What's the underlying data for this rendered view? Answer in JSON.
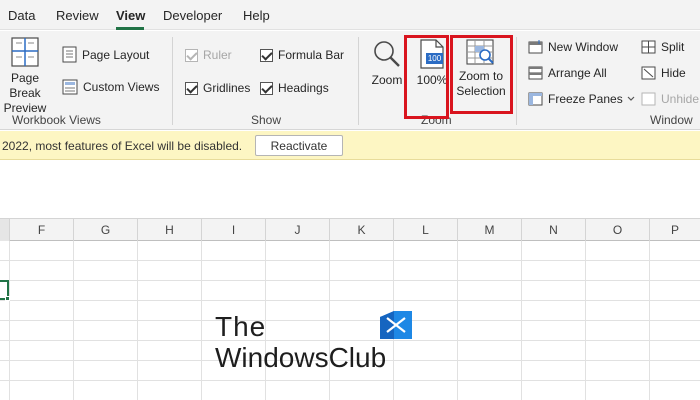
{
  "tabs": [
    {
      "label": "Data"
    },
    {
      "label": "Review"
    },
    {
      "label": "View",
      "active": true
    },
    {
      "label": "Developer"
    },
    {
      "label": "Help"
    }
  ],
  "workbook_views": {
    "group_label": "Workbook Views",
    "page_break_preview_line1": "Page Break",
    "page_break_preview_line2": "Preview",
    "page_layout": "Page Layout",
    "custom_views": "Custom Views"
  },
  "show": {
    "group_label": "Show",
    "ruler": "Ruler",
    "formula_bar": "Formula Bar",
    "gridlines": "Gridlines",
    "headings": "Headings"
  },
  "zoom": {
    "group_label": "Zoom",
    "zoom_label": "Zoom",
    "zoom_100_label": "100%",
    "zoom_100_icon_text": "100",
    "zoom_to_selection_line1": "Zoom to",
    "zoom_to_selection_line2": "Selection"
  },
  "window": {
    "group_label": "Window",
    "new_window": "New Window",
    "arrange_all": "Arrange All",
    "freeze_panes": "Freeze Panes",
    "split": "Split",
    "hide": "Hide",
    "unhide": "Unhide"
  },
  "message_bar": {
    "text": "2022, most features of Excel will be disabled.",
    "button": "Reactivate"
  },
  "columns": [
    "F",
    "G",
    "H",
    "I",
    "J",
    "K",
    "L",
    "M",
    "N",
    "O",
    "P"
  ],
  "watermark": {
    "line1": "The",
    "line2": "WindowsClub"
  },
  "colors": {
    "accent_green": "#217346",
    "highlight_red": "#d9141e",
    "message_bar_bg": "#fdf6c3",
    "logo_blue": "#1e88e5"
  }
}
